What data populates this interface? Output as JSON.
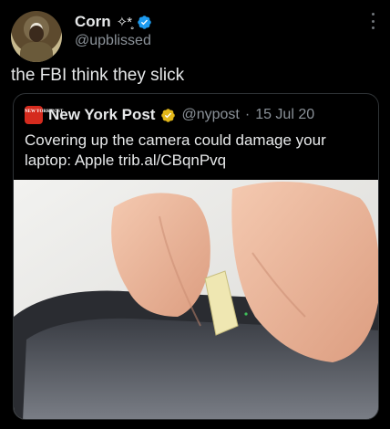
{
  "author": {
    "display_name": "Corn",
    "name_emoji": "✧*̥",
    "handle": "@upblissed",
    "avatar": "avatar-photo",
    "verified_color": "#1d9bf0"
  },
  "tweet": {
    "text": "the FBI think they slick"
  },
  "quoted_tweet": {
    "logo_text": "NEW YORK POST",
    "display_name": "New York Post",
    "handle": "@nypost",
    "separator": "·",
    "date": "15 Jul 20",
    "text": "Covering up the camera could damage your laptop: Apple trib.al/CBqnPvq",
    "verified_color": "#e2b719",
    "image": "hands-applying-tape-over-laptop-camera"
  },
  "icons": {
    "more": "more-vertical-icon",
    "verified": "verified-badge-icon",
    "gold_verified": "gold-verified-badge-icon"
  }
}
